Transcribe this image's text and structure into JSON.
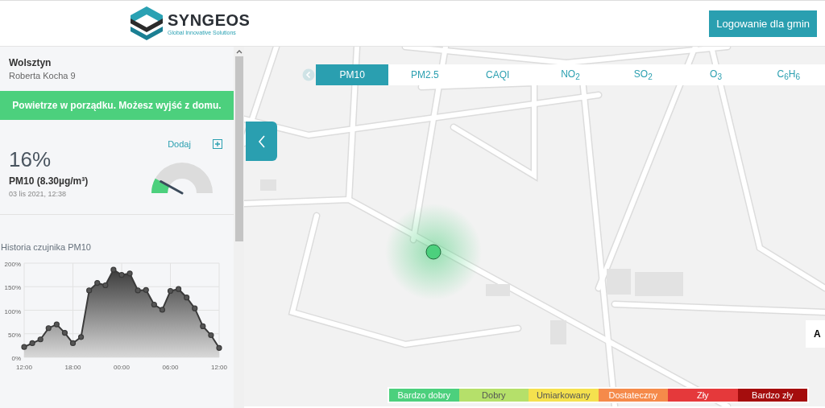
{
  "header": {
    "logo_name": "SYNGEOS",
    "logo_tagline": "Global Innovative Solutions",
    "login_button": "Logowanie dla gmin"
  },
  "sensor": {
    "city": "Wolsztyn",
    "address": "Roberta Kocha 9"
  },
  "status_banner": "Powietrze w porządku. Możesz wyjść z domu.",
  "measurement": {
    "add_link": "Dodaj",
    "percent": "16%",
    "pollutant": "PM10 (8.30µg/m³)",
    "timestamp": "03 lis 2021, 12:38",
    "level": 0.16
  },
  "history": {
    "title": "Historia czujnika PM10",
    "chart_data": {
      "type": "area",
      "categories": [
        "12:00",
        null,
        null,
        null,
        null,
        null,
        "18:00",
        null,
        null,
        null,
        null,
        null,
        "00:00",
        null,
        null,
        null,
        null,
        null,
        "06:00",
        null,
        null,
        null,
        null,
        null,
        "12:00"
      ],
      "series": [
        {
          "color": "#3a3a3a",
          "values": [
            22,
            30,
            38,
            62,
            70,
            52,
            30,
            43,
            142,
            158,
            153,
            186,
            175,
            178,
            142,
            143,
            112,
            101,
            141,
            145,
            127,
            104,
            66,
            47,
            20
          ]
        }
      ],
      "ylim": [
        0,
        200
      ],
      "grid": true,
      "yticks": [
        {
          "value": 0,
          "label": "0%"
        },
        {
          "value": 50,
          "label": "50%"
        },
        {
          "value": 100,
          "label": "100%"
        },
        {
          "value": 150,
          "label": "150%"
        },
        {
          "value": 200,
          "label": "200%"
        }
      ]
    }
  },
  "tabs": [
    {
      "label": "PM10",
      "selected": true
    },
    {
      "label": "PM2.5",
      "selected": false
    },
    {
      "label": "CAQI",
      "selected": false
    },
    {
      "label": "NO$_{2}$",
      "selected": false
    },
    {
      "label": "SO$_{2}$",
      "selected": false
    },
    {
      "label": "O$_{3}$",
      "selected": false
    },
    {
      "label": "C$_{6}$H$_{6}$",
      "selected": false
    }
  ],
  "map_side_control": "A",
  "legend": [
    {
      "label": "Bardzo dobry",
      "color": "#4cd07d"
    },
    {
      "label": "Dobry",
      "color": "#b5e06a"
    },
    {
      "label": "Umiarkowany",
      "color": "#f5e14e"
    },
    {
      "label": "Dostateczny",
      "color": "#f58a4a"
    },
    {
      "label": "Zły",
      "color": "#e5393b"
    },
    {
      "label": "Bardzo zły",
      "color": "#a50d0d"
    }
  ]
}
